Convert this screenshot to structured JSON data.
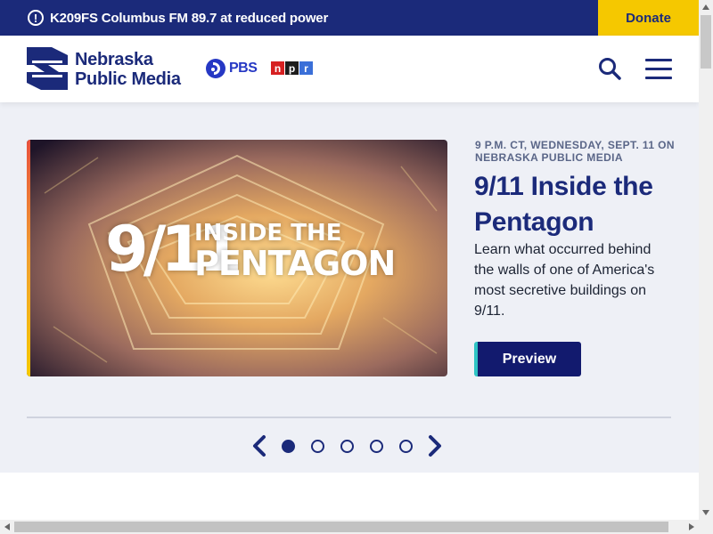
{
  "alert": {
    "icon": "alert-circle-icon",
    "text": "K209FS Columbus FM 89.7 at reduced power"
  },
  "donate_label": "Donate",
  "header": {
    "logo_line1": "Nebraska",
    "logo_line2": "Public Media",
    "pbs_label": "PBS",
    "npr_letters": [
      "n",
      "p",
      "r"
    ],
    "search_icon": "search-icon",
    "menu_icon": "hamburger-menu-icon"
  },
  "hero": {
    "image_title_number": "9/11",
    "image_title_line1": "INSIDE THE",
    "image_title_line2": "PENTAGON",
    "kicker": "9 P.M. CT, WEDNESDAY, SEPT. 11 ON NEBRASKA PUBLIC MEDIA",
    "headline": "9/11 Inside the Pentagon",
    "description": "Learn what occurred behind the walls of one of America's most secretive buildings on 9/11.",
    "button_label": "Preview"
  },
  "carousel": {
    "slides": 5,
    "active_index": 0
  },
  "colors": {
    "brand_navy": "#1b2a7a",
    "donate_yellow": "#f5c800",
    "npr_red": "#d62021",
    "npr_blue": "#3a6fd8",
    "pbs_blue": "#2638c4"
  }
}
